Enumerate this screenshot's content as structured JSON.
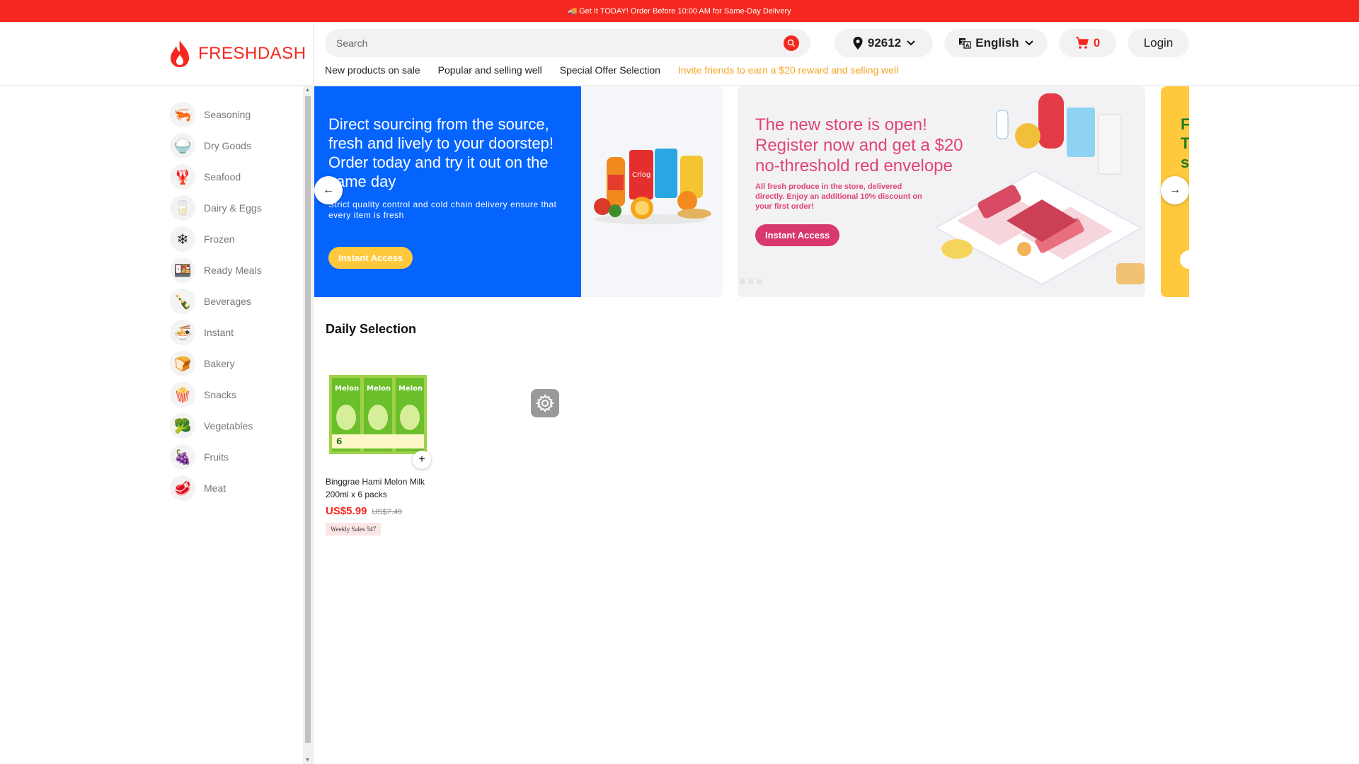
{
  "banner": {
    "text": "Get It TODAY! Order Before 10:00 AM for Same-Day Delivery"
  },
  "brand": {
    "name": "FRESHDASH",
    "color": "#f5281f"
  },
  "search": {
    "placeholder": "Search"
  },
  "location": {
    "zip": "92612"
  },
  "language": {
    "label": "English"
  },
  "cart": {
    "count": "0"
  },
  "auth": {
    "login_label": "Login"
  },
  "nav": {
    "items": [
      "New products on sale",
      "Popular and selling well",
      "Special Offer Selection",
      "Invite friends to earn a $20 reward and selling well"
    ]
  },
  "categories": [
    {
      "label": "Seasoning",
      "icon": "seasoning-icon"
    },
    {
      "label": "Dry Goods",
      "icon": "rice-icon"
    },
    {
      "label": "Seafood",
      "icon": "seafood-icon"
    },
    {
      "label": "Dairy & Eggs",
      "icon": "dairy-icon"
    },
    {
      "label": "Frozen",
      "icon": "frozen-icon"
    },
    {
      "label": "Ready Meals",
      "icon": "ready-meals-icon"
    },
    {
      "label": "Beverages",
      "icon": "beverages-icon"
    },
    {
      "label": "Instant",
      "icon": "instant-noodles-icon"
    },
    {
      "label": "Bakery",
      "icon": "bakery-icon"
    },
    {
      "label": "Snacks",
      "icon": "snacks-icon"
    },
    {
      "label": "Vegetables",
      "icon": "vegetables-icon"
    },
    {
      "label": "Fruits",
      "icon": "fruits-icon"
    },
    {
      "label": "Meat",
      "icon": "meat-icon"
    }
  ],
  "carousel": {
    "slides": [
      {
        "headline": "Direct sourcing from the source, fresh and lively to your doorstep! Order today and try it out on the same day",
        "subtext": "Strict quality control and cold chain delivery ensure that every item is fresh",
        "cta": "Instant Access",
        "bg": "#0564fd"
      },
      {
        "headline": "The new store is open! Register now and get a $20 no-threshold red envelope",
        "subtext": "All fresh produce in the store, delivered directly. Enjoy an additional 10% discount on your first order!",
        "cta": "Instant Access",
        "accent": "#e0437a"
      },
      {
        "headline_partial": "F T s",
        "bg": "#ffc83d"
      }
    ]
  },
  "daily": {
    "title": "Daily Selection",
    "products": [
      {
        "name": "Binggrae Hami Melon Milk 200ml x 6 packs",
        "price": "US$5.99",
        "old_price": "US$7.49",
        "badge": "Weekly Sales 547",
        "package_text": "Melon"
      }
    ]
  }
}
